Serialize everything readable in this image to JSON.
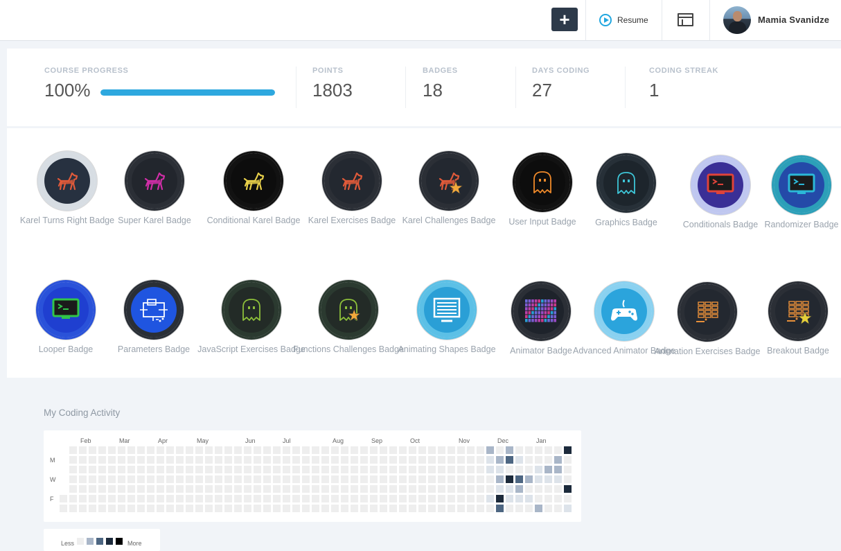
{
  "topbar": {
    "add_label": "+",
    "resume_label": "Resume",
    "user_name": "Mamia Svanidze"
  },
  "stats": {
    "course_progress": {
      "label": "COURSE PROGRESS",
      "value": "100%",
      "fraction": 1.0
    },
    "points": {
      "label": "POINTS",
      "value": "1803"
    },
    "badges": {
      "label": "BADGES",
      "value": "18"
    },
    "days_coding": {
      "label": "DAYS CODING",
      "value": "27"
    },
    "coding_streak": {
      "label": "CODING STREAK",
      "value": "1"
    }
  },
  "badges": [
    {
      "label": "Karel Turns Right Badge",
      "icon": "karel-dog-icon",
      "color": "#e05a3a",
      "ring": "#d7dde3",
      "fill": "#273140"
    },
    {
      "label": "Super Karel Badge",
      "icon": "karel-dog-icon",
      "color": "#d12ea8",
      "ring": "#2b2f36",
      "fill": "#22262d"
    },
    {
      "label": "Conditional Karel Badge",
      "icon": "karel-dog-icon",
      "color": "#e8d04a",
      "ring": "#121212",
      "fill": "#0d0d0d"
    },
    {
      "label": "Karel Exercises Badge",
      "icon": "karel-dog-icon",
      "color": "#e05a3a",
      "ring": "#2b2f36",
      "fill": "#232830"
    },
    {
      "label": "Karel Challenges Badge",
      "icon": "karel-dog-star-icon",
      "color": "#e05a3a",
      "ring": "#2b2f36",
      "fill": "#232830"
    },
    {
      "label": "User Input Badge",
      "icon": "ghost-icon",
      "color": "#f08a2a",
      "ring": "#121212",
      "fill": "#0d0d0d"
    },
    {
      "label": "Graphics Badge",
      "icon": "ghost-icon",
      "color": "#3ec6d8",
      "ring": "#273038",
      "fill": "#1d252c"
    },
    {
      "label": "Conditionals Badge",
      "icon": "terminal-icon",
      "color": "#e0433a",
      "ring": "#bfc7f0",
      "fill": "#3a2f96"
    },
    {
      "label": "Randomizer Badge",
      "icon": "terminal-icon",
      "color": "#2bb8d8",
      "ring": "#2c9fb8",
      "fill": "#244aa8"
    },
    {
      "label": "Looper Badge",
      "icon": "terminal-icon",
      "color": "#31c54a",
      "ring": "#2a52d9",
      "fill": "#1f3fd0"
    },
    {
      "label": "Parameters Badge",
      "icon": "function-diagram-icon",
      "color": "#ffffff",
      "ring": "#2a2f36",
      "fill": "#1f55e0"
    },
    {
      "label": "JavaScript Exercises Badge",
      "icon": "ghost-icon",
      "color": "#8dbf3a",
      "ring": "#2b3a30",
      "fill": "#232b27"
    },
    {
      "label": "Functions Challenges Badge",
      "icon": "ghost-star-icon",
      "color": "#8dbf3a",
      "ring": "#2b3a30",
      "fill": "#232b27"
    },
    {
      "label": "Animating Shapes Badge",
      "icon": "monitor-icon",
      "color": "#ffffff",
      "ring": "#5cc0e6",
      "fill": "#2a9fd6"
    },
    {
      "label": "Animator Badge",
      "icon": "pixel-grid-icon",
      "color": "#c83a8a",
      "ring": "#2b2f36",
      "fill": "#1e232b"
    },
    {
      "label": "Advanced Animator Badge",
      "icon": "gamepad-icon",
      "color": "#ffffff",
      "ring": "#8ad1f0",
      "fill": "#2ba4dc"
    },
    {
      "label": "Animation Exercises Badge",
      "icon": "brick-wall-icon",
      "color": "#e8903a",
      "ring": "#2b2f36",
      "fill": "#232830"
    },
    {
      "label": "Breakout Badge",
      "icon": "brick-wall-star-icon",
      "color": "#e8903a",
      "ring": "#2b2f36",
      "fill": "#232830"
    }
  ],
  "activity": {
    "title": "My Coding Activity",
    "months": [
      "Feb",
      "Mar",
      "Apr",
      "May",
      "Jun",
      "Jul",
      "Aug",
      "Sep",
      "Oct",
      "Nov",
      "Dec",
      "Jan"
    ],
    "day_labels": [
      "M",
      "W",
      "F"
    ],
    "levels": {
      "44-0": 2,
      "44-1": 1,
      "44-2": 1,
      "44-5": 1,
      "45-1": 2,
      "45-2": 1,
      "45-3": 2,
      "45-4": 1,
      "45-5": 4,
      "45-6": 3,
      "46-0": 2,
      "46-1": 3,
      "46-3": 4,
      "46-4": 1,
      "46-5": 1,
      "47-1": 1,
      "47-3": 3,
      "47-4": 2,
      "47-5": 1,
      "48-3": 2,
      "48-5": 1,
      "49-2": 1,
      "49-3": 1,
      "49-6": 2,
      "50-2": 2,
      "50-3": 1,
      "51-1": 2,
      "51-2": 2,
      "51-3": 1,
      "52-0": 4,
      "52-4": 4,
      "52-6": 1
    },
    "legend": {
      "less": "Less",
      "more": "More"
    },
    "level_colors": [
      "#eeeeee",
      "#dde3ea",
      "#a9b6c8",
      "#4d6682",
      "#1c2a3b",
      "#000000"
    ]
  }
}
